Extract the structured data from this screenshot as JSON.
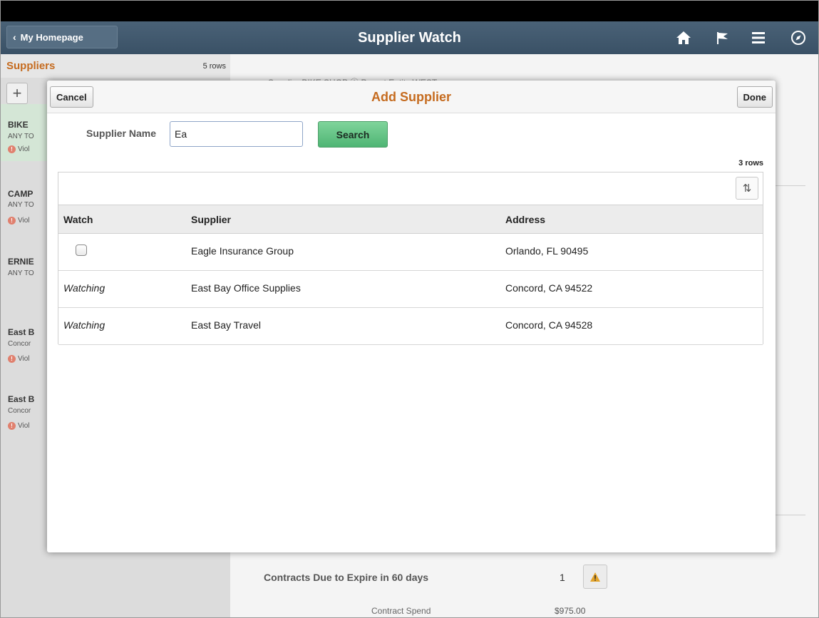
{
  "navbar": {
    "back_label": "My Homepage",
    "title": "Supplier Watch",
    "icons": [
      "home-icon",
      "flag-icon",
      "menu-icon",
      "compass-icon"
    ]
  },
  "background": {
    "list_title": "Suppliers",
    "list_rowcount": "5 rows",
    "items": [
      {
        "title": "BIKE",
        "sub": "ANY TO",
        "status": "Viol"
      },
      {
        "title": "CAMP",
        "sub": "ANY TO",
        "status": "Viol"
      },
      {
        "title": "ERNIE",
        "sub": "ANY TO",
        "status": ""
      },
      {
        "title": "East B",
        "sub": "Concor",
        "status": "Viol"
      },
      {
        "title": "East B",
        "sub": "Concor",
        "status": "Viol"
      }
    ],
    "header_text": "Supplier  BIKE SHOP ⓘ            Parent Entity  WEST",
    "contracts_label": "Contracts Due to Expire in 60 days",
    "contracts_count": "1",
    "spend_label": "Contract Spend",
    "spend_value": "$975.00"
  },
  "modal": {
    "cancel_label": "Cancel",
    "title": "Add Supplier",
    "done_label": "Done",
    "search_label": "Supplier Name",
    "search_value": "Ea",
    "search_button": "Search",
    "rowcount": "3 rows",
    "columns": {
      "watch": "Watch",
      "supplier": "Supplier",
      "address": "Address"
    },
    "rows": [
      {
        "watch": "",
        "supplier": "Eagle Insurance Group",
        "address": "Orlando, FL  90495"
      },
      {
        "watch": "Watching",
        "supplier": "East Bay Office Supplies",
        "address": "Concord, CA  94522"
      },
      {
        "watch": "Watching",
        "supplier": "East Bay Travel",
        "address": "Concord, CA  94528"
      }
    ]
  }
}
